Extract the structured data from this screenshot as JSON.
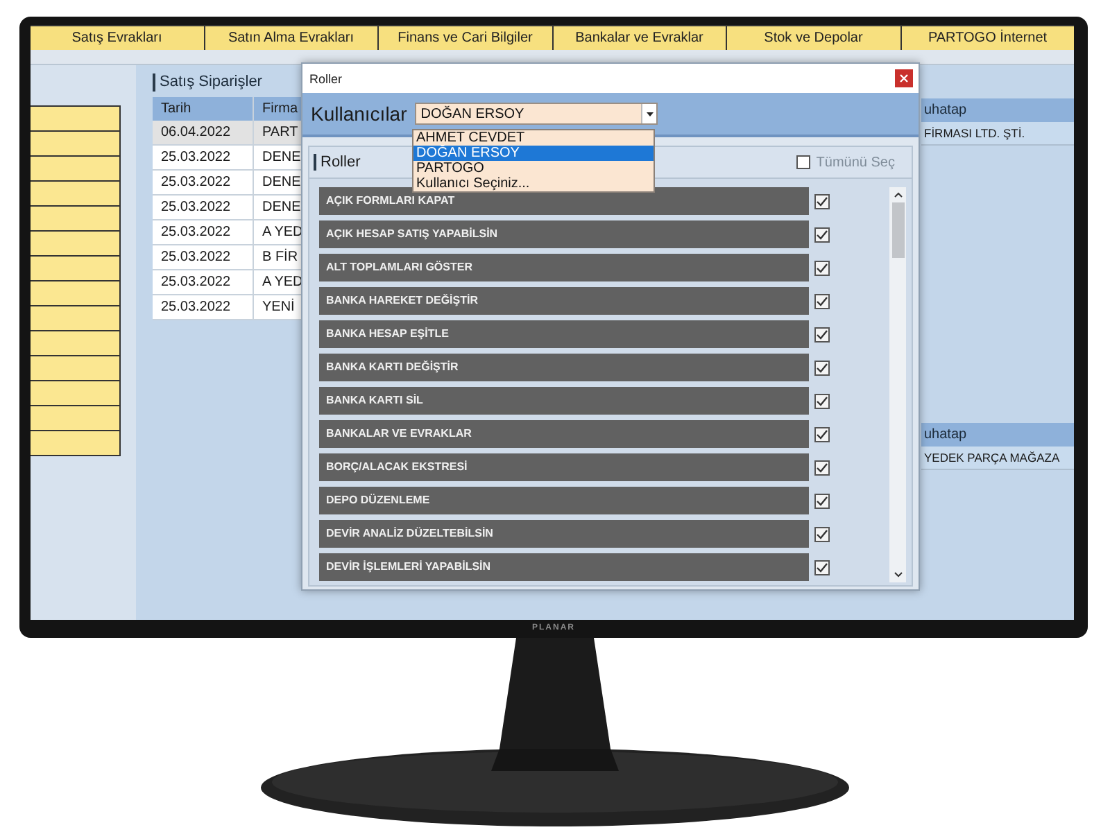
{
  "menu_tabs": [
    "Satış Evrakları",
    "Satın Alma Evrakları",
    "Finans ve Cari Bilgiler",
    "Bankalar ve Evraklar",
    "Stok ve Depolar",
    "PARTOGO İnternet"
  ],
  "orders_panel": {
    "title": "Satış Siparişler",
    "columns": [
      "Tarih",
      "Firma"
    ],
    "rows": [
      {
        "cells": [
          "06.04.2022",
          "PART"
        ],
        "selected": true
      },
      {
        "cells": [
          "25.03.2022",
          "DENE"
        ],
        "selected": false
      },
      {
        "cells": [
          "25.03.2022",
          "DENE"
        ],
        "selected": false
      },
      {
        "cells": [
          "25.03.2022",
          "DENE"
        ],
        "selected": false
      },
      {
        "cells": [
          "25.03.2022",
          "A YED"
        ],
        "selected": false
      },
      {
        "cells": [
          "25.03.2022",
          "B FİR"
        ],
        "selected": false
      },
      {
        "cells": [
          "25.03.2022",
          "A YED"
        ],
        "selected": false
      },
      {
        "cells": [
          "25.03.2022",
          "YENİ"
        ],
        "selected": false
      }
    ]
  },
  "right_panel": {
    "upper_table": {
      "column": "uhatap",
      "rows": [
        "FİRMASI LTD. ŞTİ."
      ]
    },
    "lower_table": {
      "column": "uhatap",
      "rows": [
        "YEDEK PARÇA MAĞAZA"
      ]
    }
  },
  "dialog": {
    "title": "Roller",
    "users_label": "Kullanıcılar",
    "users_value": "DOĞAN ERSOY",
    "users_options": [
      {
        "label": "AHMET CEVDET",
        "selected": false
      },
      {
        "label": "DOĞAN ERSOY",
        "selected": true
      },
      {
        "label": "PARTOGO",
        "selected": false
      },
      {
        "label": "Kullanıcı Seçiniz...",
        "selected": false
      }
    ],
    "roles_title": "Roller",
    "select_all": {
      "label": "Tümünü Seç",
      "checked": false,
      "disabled": true
    },
    "roles": [
      {
        "label": "AÇIK FORMLARI KAPAT",
        "checked": true
      },
      {
        "label": "AÇIK HESAP SATIŞ YAPABİLSİN",
        "checked": true
      },
      {
        "label": "ALT TOPLAMLARI GÖSTER",
        "checked": true
      },
      {
        "label": "BANKA HAREKET DEĞİŞTİR",
        "checked": true
      },
      {
        "label": "BANKA HESAP EŞİTLE",
        "checked": true
      },
      {
        "label": "BANKA KARTI DEĞİŞTİR",
        "checked": true
      },
      {
        "label": "BANKA KARTI SİL",
        "checked": true
      },
      {
        "label": "BANKALAR VE EVRAKLAR",
        "checked": true
      },
      {
        "label": "BORÇ/ALACAK EKSTRESİ",
        "checked": true
      },
      {
        "label": "DEPO DÜZENLEME",
        "checked": true
      },
      {
        "label": "DEVİR ANALİZ DÜZELTEBİLSİN",
        "checked": true
      },
      {
        "label": "DEVİR İŞLEMLERİ YAPABİLSİN",
        "checked": true
      }
    ]
  },
  "monitor": {
    "brand": "PLANAR"
  }
}
